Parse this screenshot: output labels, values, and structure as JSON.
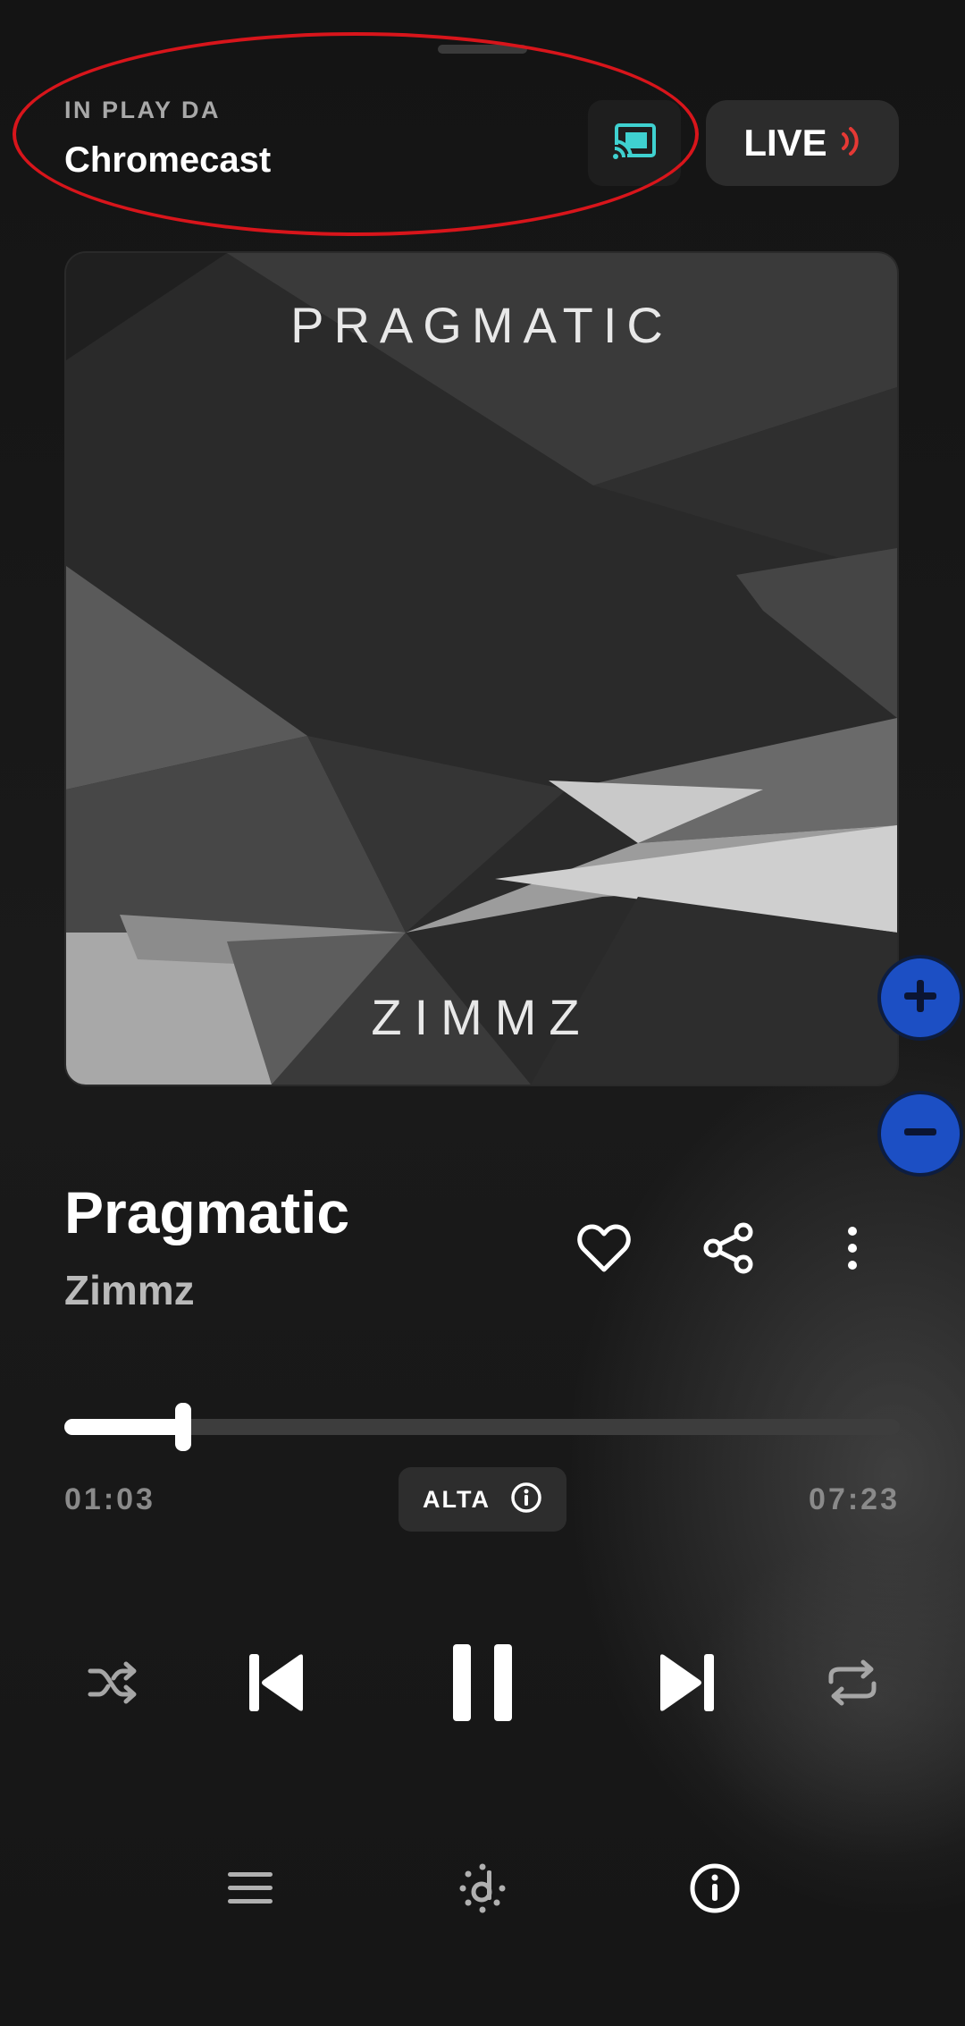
{
  "cast": {
    "caption": "IN PLAY DA",
    "device_name": "Chromecast",
    "cast_icon": "cast-connected-icon",
    "accent_color": "#3fd1d0"
  },
  "live": {
    "label": "LIVE",
    "icon": "live-waves-icon",
    "accent_color": "#e53935"
  },
  "album": {
    "cover_title": "PRAGMATIC",
    "cover_artist": "ZIMMZ"
  },
  "zoom": {
    "plus_icon": "plus-icon",
    "minus_icon": "minus-icon",
    "color": "#1c4fc4"
  },
  "track": {
    "title": "Pragmatic",
    "artist": "Zimmz"
  },
  "actions": [
    "heart-icon",
    "share-icon",
    "more-vertical-icon"
  ],
  "playback": {
    "elapsed": "01:03",
    "duration": "07:23",
    "progress_fraction": 0.142,
    "quality_label": "ALTA",
    "quality_icon": "info-icon"
  },
  "controls": [
    "shuffle-icon",
    "previous-icon",
    "pause-icon",
    "next-icon",
    "repeat-icon"
  ],
  "bottom_bar": [
    "queue-menu-icon",
    "deezer-logo-icon",
    "info-icon"
  ],
  "annotation": {
    "highlight_color": "#d8151b"
  }
}
